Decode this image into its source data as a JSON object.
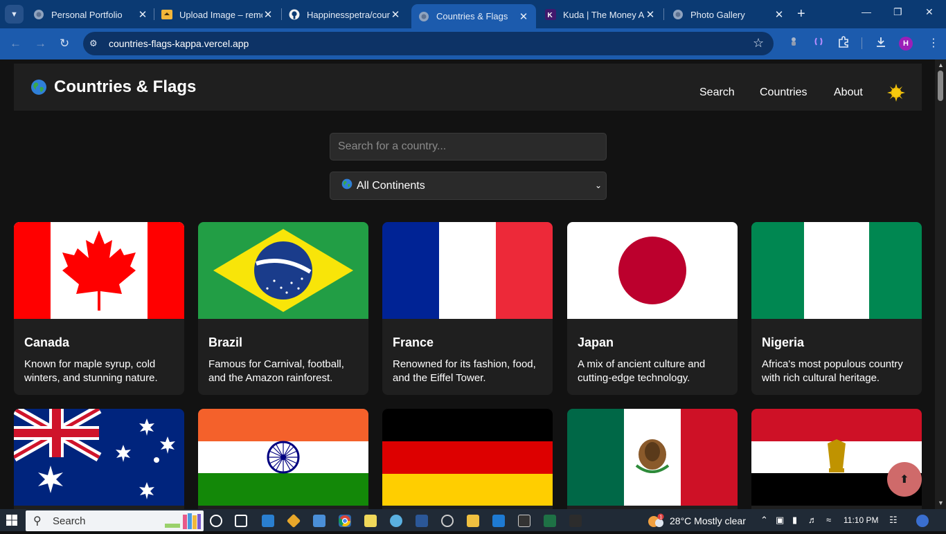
{
  "browser": {
    "tabs": [
      {
        "title": "Personal Portfolio",
        "icon": "globe-icon"
      },
      {
        "title": "Upload Image – remo",
        "icon": "upload-favicon"
      },
      {
        "title": "Happinesspetra/coun",
        "icon": "github-icon"
      },
      {
        "title": "Countries & Flags",
        "icon": "globe-icon",
        "active": true
      },
      {
        "title": "Kuda | The Money Ap",
        "icon": "kuda-icon"
      },
      {
        "title": "Photo Gallery",
        "icon": "globe-icon"
      }
    ],
    "url": "countries-flags-kappa.vercel.app",
    "profile_initial": "H",
    "accent": "#1c5bad"
  },
  "site": {
    "title": "Countries & Flags",
    "nav": {
      "search": "Search",
      "countries": "Countries",
      "about": "About"
    },
    "theme_toggle_icon": "sun-icon"
  },
  "search": {
    "placeholder": "Search for a country..."
  },
  "filter": {
    "selected": "All Continents",
    "icon": "globe-icon"
  },
  "countries": [
    {
      "name": "Canada",
      "desc": "Known for maple syrup, cold winters, and stunning nature.",
      "flag": "canada"
    },
    {
      "name": "Brazil",
      "desc": "Famous for Carnival, football, and the Amazon rainforest.",
      "flag": "brazil"
    },
    {
      "name": "France",
      "desc": "Renowned for its fashion, food, and the Eiffel Tower.",
      "flag": "france"
    },
    {
      "name": "Japan",
      "desc": "A mix of ancient culture and cutting-edge technology.",
      "flag": "japan"
    },
    {
      "name": "Nigeria",
      "desc": "Africa's most populous country with rich cultural heritage.",
      "flag": "nigeria"
    },
    {
      "name": "",
      "desc": "",
      "flag": "australia"
    },
    {
      "name": "",
      "desc": "",
      "flag": "india"
    },
    {
      "name": "",
      "desc": "",
      "flag": "germany"
    },
    {
      "name": "",
      "desc": "",
      "flag": "mexico"
    },
    {
      "name": "",
      "desc": "",
      "flag": "egypt"
    }
  ],
  "taskbar": {
    "search_label": "Search",
    "weather": "28°C  Mostly clear",
    "time": "11:10 PM",
    "weather_badge": "1"
  }
}
